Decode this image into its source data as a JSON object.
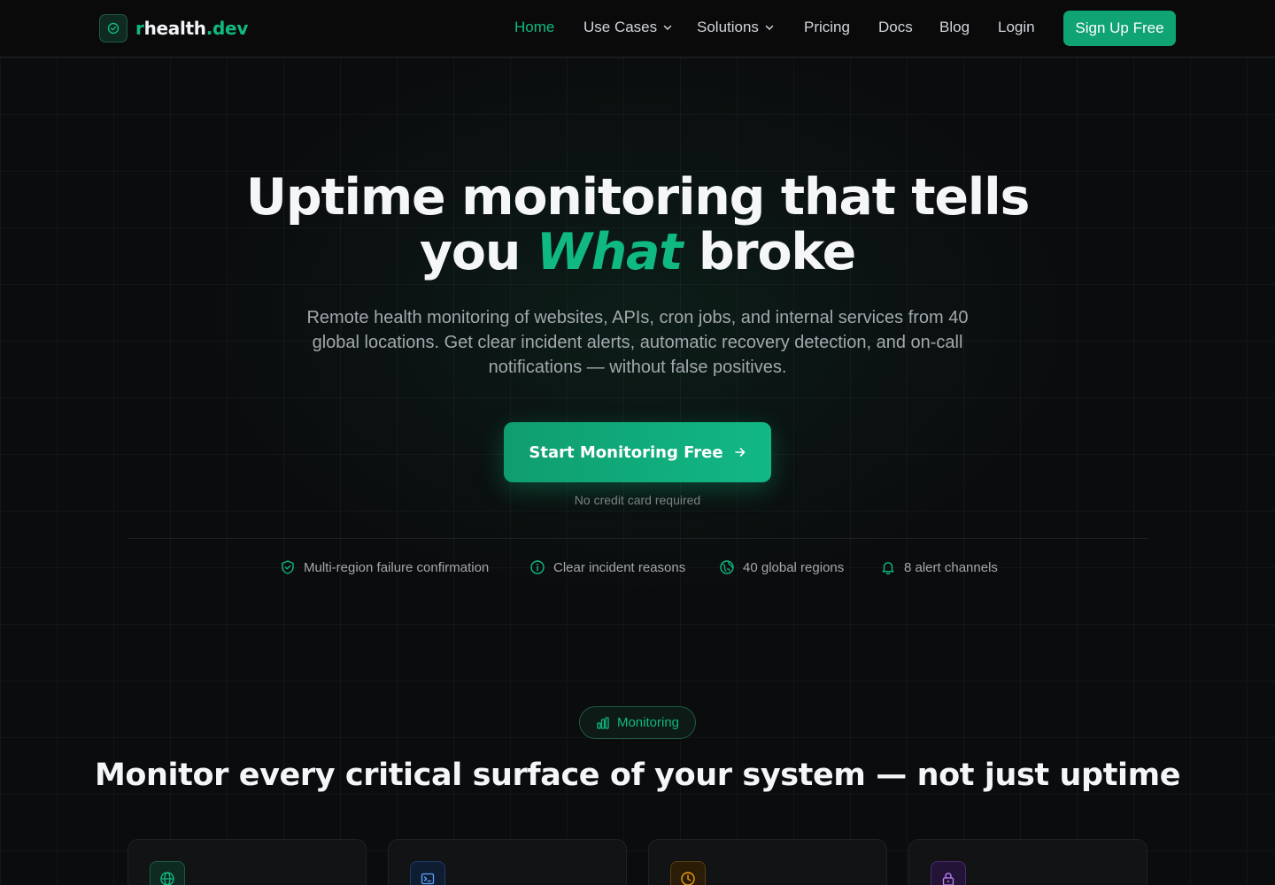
{
  "nav": {
    "logo_prefix": "r",
    "logo_main": "health",
    "logo_suffix": ".dev",
    "links": [
      {
        "label": "Home",
        "active": true
      },
      {
        "label": "Use Cases",
        "dropdown": true
      },
      {
        "label": "Solutions",
        "dropdown": true
      },
      {
        "label": "Pricing"
      },
      {
        "label": "Docs"
      },
      {
        "label": "Blog"
      },
      {
        "label": "Login"
      }
    ],
    "signup_label": "Sign Up Free"
  },
  "hero": {
    "title_line1": "Uptime monitoring that tells",
    "title_line2_a": "you ",
    "title_line2_em": "What",
    "title_line2_b": " broke",
    "subtitle": "Remote health monitoring of websites, APIs, cron jobs, and internal services from 40 global locations. Get clear incident alerts, automatic recovery detection, and on-call notifications — without false positives.",
    "cta_label": "Start Monitoring Free",
    "cta_note": "No credit card required"
  },
  "features": [
    {
      "icon": "shield-check-icon",
      "label": "Multi-region failure confirmation"
    },
    {
      "icon": "info-circle-icon",
      "label": "Clear incident reasons"
    },
    {
      "icon": "globe-icon",
      "label": "40 global regions"
    },
    {
      "icon": "bell-icon",
      "label": "8 alert channels"
    }
  ],
  "monitoring": {
    "pill_label": "Monitoring",
    "title": "Monitor every critical surface of your system — not just uptime",
    "cards": [
      {
        "icon": "globe-icon",
        "color": "#10b981"
      },
      {
        "icon": "terminal-icon",
        "color": "#3b82f6"
      },
      {
        "icon": "clock-icon",
        "color": "#f59e0b"
      },
      {
        "icon": "lock-icon",
        "color": "#a855f7"
      }
    ]
  },
  "colors": {
    "accent": "#10b981",
    "background": "#0b0c0d"
  }
}
